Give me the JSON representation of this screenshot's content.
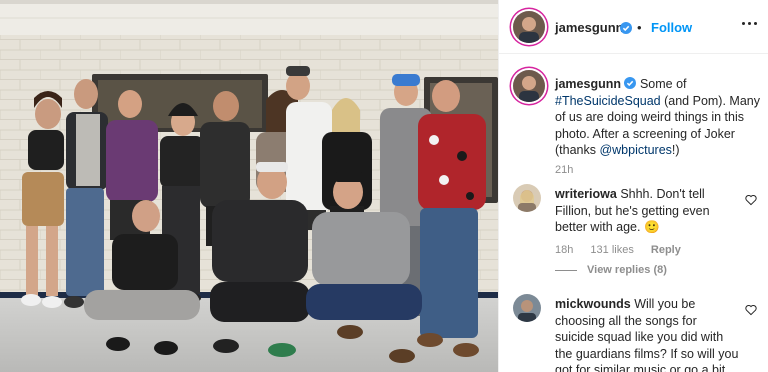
{
  "post": {
    "photo_alt": "photo",
    "author": {
      "username": "jamesgunn",
      "verified": true
    },
    "follow_label": "Follow",
    "separator": "•",
    "more_icon": "more-options-icon",
    "caption": {
      "username": "jamesgunn",
      "text_before": "Some of ",
      "hashtag": "#TheSuicideSquad",
      "text_middle": " (and Pom). Many of us are doing weird things in this photo. After a screening of Joker (thanks ",
      "mention": "@wbpictures",
      "text_after": "!)"
    },
    "time": "21h"
  },
  "comments": [
    {
      "username": "writeriowa",
      "text": "Shhh. Don't tell Fillion, but he's getting even better with age. 🙂",
      "time": "18h",
      "likes": "131 likes",
      "reply_label": "Reply",
      "view_replies": "View replies (8)"
    },
    {
      "username": "mickwounds",
      "text": "Will you be choosing all the songs for suicide squad like you did with the guardians films? If so will you got for similar music or go a bit"
    }
  ],
  "colors": {
    "accent": "#0095f6",
    "link": "#00376b",
    "muted": "#8e8e8e",
    "verified": "#3897f0",
    "wall": "#e4e0d6",
    "floor": "#c9c9c7"
  }
}
